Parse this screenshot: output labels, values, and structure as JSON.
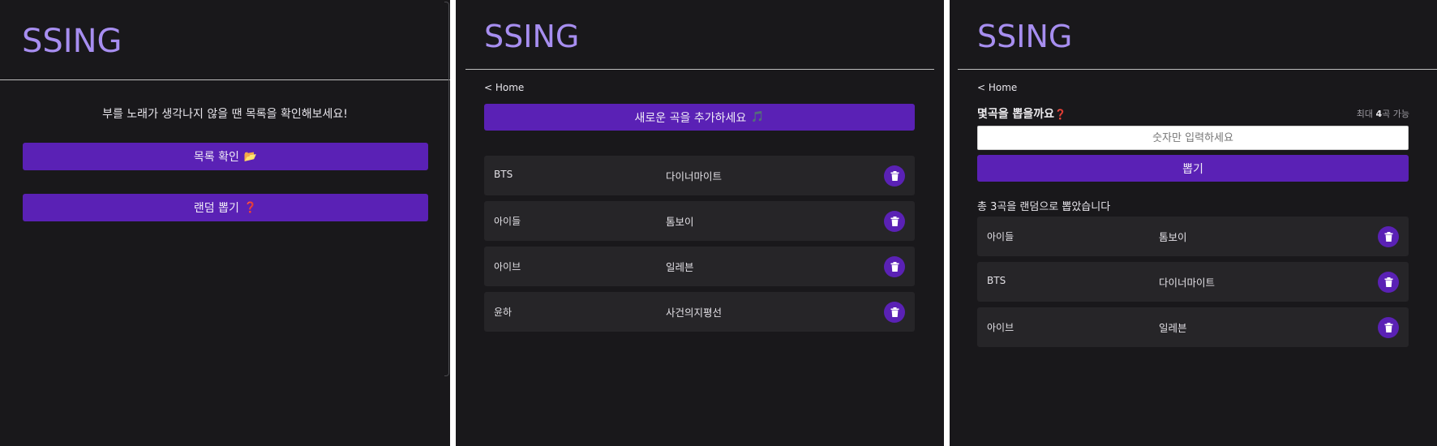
{
  "brand": "SSING",
  "home_panel": {
    "prompt": "부를 노래가 생각나지 않을 땐 목록을 확인해보세요!",
    "list_button": "목록 확인",
    "list_button_emoji": "📂",
    "random_button": "랜덤 뽑기",
    "random_button_emoji": "❓"
  },
  "list_panel": {
    "back_link": "< Home",
    "add_button": "새로운 곡을 추가하세요",
    "add_button_emoji": "🎵",
    "songs": [
      {
        "artist": "BTS",
        "title": "다이너마이트"
      },
      {
        "artist": "아이들",
        "title": "톰보이"
      },
      {
        "artist": "아이브",
        "title": "일레븐"
      },
      {
        "artist": "윤하",
        "title": "사건의지평선"
      }
    ]
  },
  "random_panel": {
    "back_link": "< Home",
    "question": "몇곡을 뽑을까요",
    "question_emoji": "❓",
    "max_hint_prefix": "최대 ",
    "max_hint_count": "4",
    "max_hint_suffix": "곡 가능",
    "input_placeholder": "숫자만 입력하세요",
    "draw_button": "뽑기",
    "result_text": "총 3곡을 랜덤으로 뽑았습니다",
    "results": [
      {
        "artist": "아이들",
        "title": "톰보이"
      },
      {
        "artist": "BTS",
        "title": "다이너마이트"
      },
      {
        "artist": "아이브",
        "title": "일레븐"
      }
    ]
  },
  "colors": {
    "background": "#19181b",
    "brand": "#a78ef0",
    "accent": "#5a21b5",
    "row": "#262528"
  },
  "icons": {
    "delete": "trash-icon"
  }
}
